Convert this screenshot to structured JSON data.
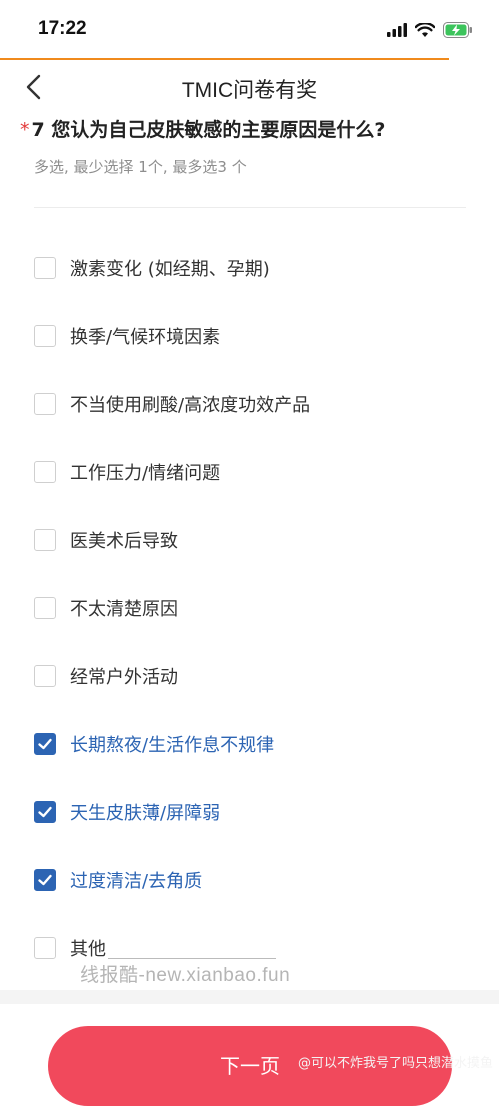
{
  "status_bar": {
    "time": "17:22"
  },
  "header": {
    "title": "TMIC问卷有奖"
  },
  "question": {
    "required_mark": "*",
    "title": "7 您认为自己皮肤敏感的主要原因是什么?",
    "hint": "多选, 最少选择 1个, 最多选3 个"
  },
  "options": [
    {
      "label": "激素变化 (如经期、孕期)",
      "checked": false
    },
    {
      "label": "换季/气候环境因素",
      "checked": false
    },
    {
      "label": "不当使用刷酸/高浓度功效产品",
      "checked": false
    },
    {
      "label": "工作压力/情绪问题",
      "checked": false
    },
    {
      "label": "医美术后导致",
      "checked": false
    },
    {
      "label": "不太清楚原因",
      "checked": false
    },
    {
      "label": "经常户外活动",
      "checked": false
    },
    {
      "label": "长期熬夜/生活作息不规律",
      "checked": true
    },
    {
      "label": "天生皮肤薄/屏障弱",
      "checked": true
    },
    {
      "label": "过度清洁/去角质",
      "checked": true
    },
    {
      "label": "其他",
      "checked": false,
      "has_text_field": true
    }
  ],
  "footer": {
    "next_label": "下一页"
  },
  "watermarks": {
    "site": "线报酷-new.xianbao.fun",
    "user": "@可以不炸我号了吗只想潜水摸鱼"
  },
  "colors": {
    "accent": "#2c64b3",
    "progress": "#f08a1c",
    "button": "#f1495c",
    "required": "#e23a3a"
  }
}
